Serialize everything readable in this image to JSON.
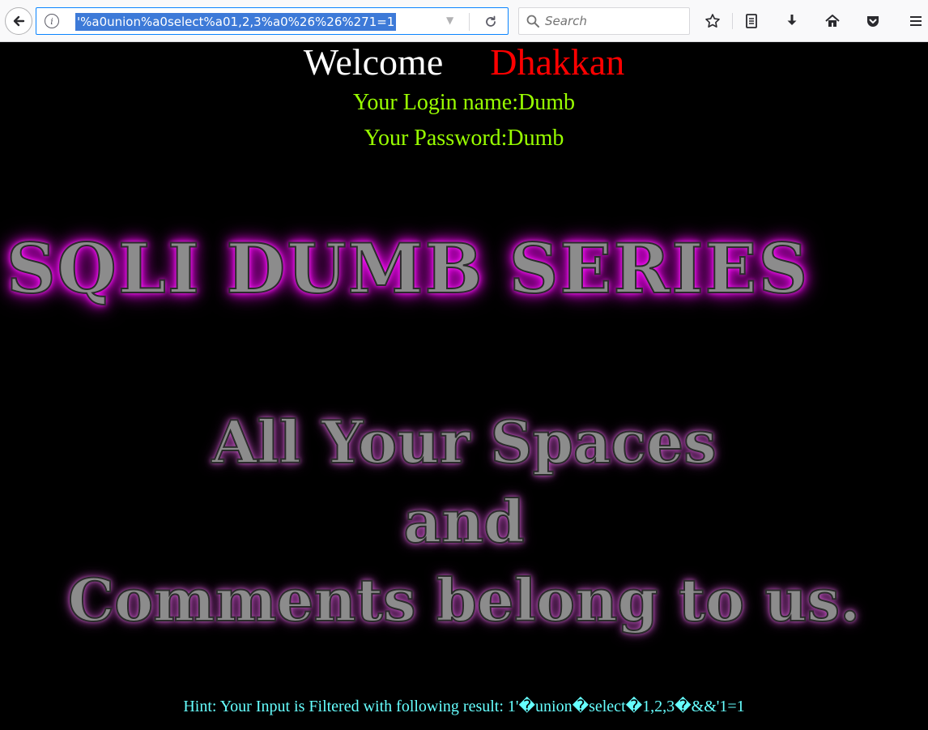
{
  "browser": {
    "url": "'%a0union%a0select%a01,2,3%a0%26%26%271=1",
    "search_placeholder": "Search",
    "icons": {
      "back": "back-arrow-icon",
      "info": "info-icon",
      "reload": "reload-icon",
      "search": "search-icon",
      "bookmark": "star-icon",
      "reader": "reading-list-icon",
      "download": "download-icon",
      "home": "home-icon",
      "pocket": "pocket-icon",
      "menu": "hamburger-menu-icon"
    }
  },
  "page": {
    "welcome_word": "Welcome",
    "welcome_name": "Dhakkan",
    "login_name": "Your Login name:Dumb",
    "password": "Your Password:Dumb",
    "banner_title": "SQLI DUMB SERIES",
    "banner_sub_1": "All Your Spaces",
    "banner_sub_2": "and",
    "banner_sub_3": "Comments belong to us.",
    "hint": "Hint: Your Input is Filtered with following result: 1'�union�select�1,2,3�&&'1=1"
  },
  "colors": {
    "background": "#000000",
    "welcome_word": "#ffffff",
    "welcome_name": "#ff0000",
    "login_text": "#99ff00",
    "banner_glow": "#ff00ff",
    "hint_text": "#66ffff",
    "url_highlight": "#3d7ad8"
  }
}
